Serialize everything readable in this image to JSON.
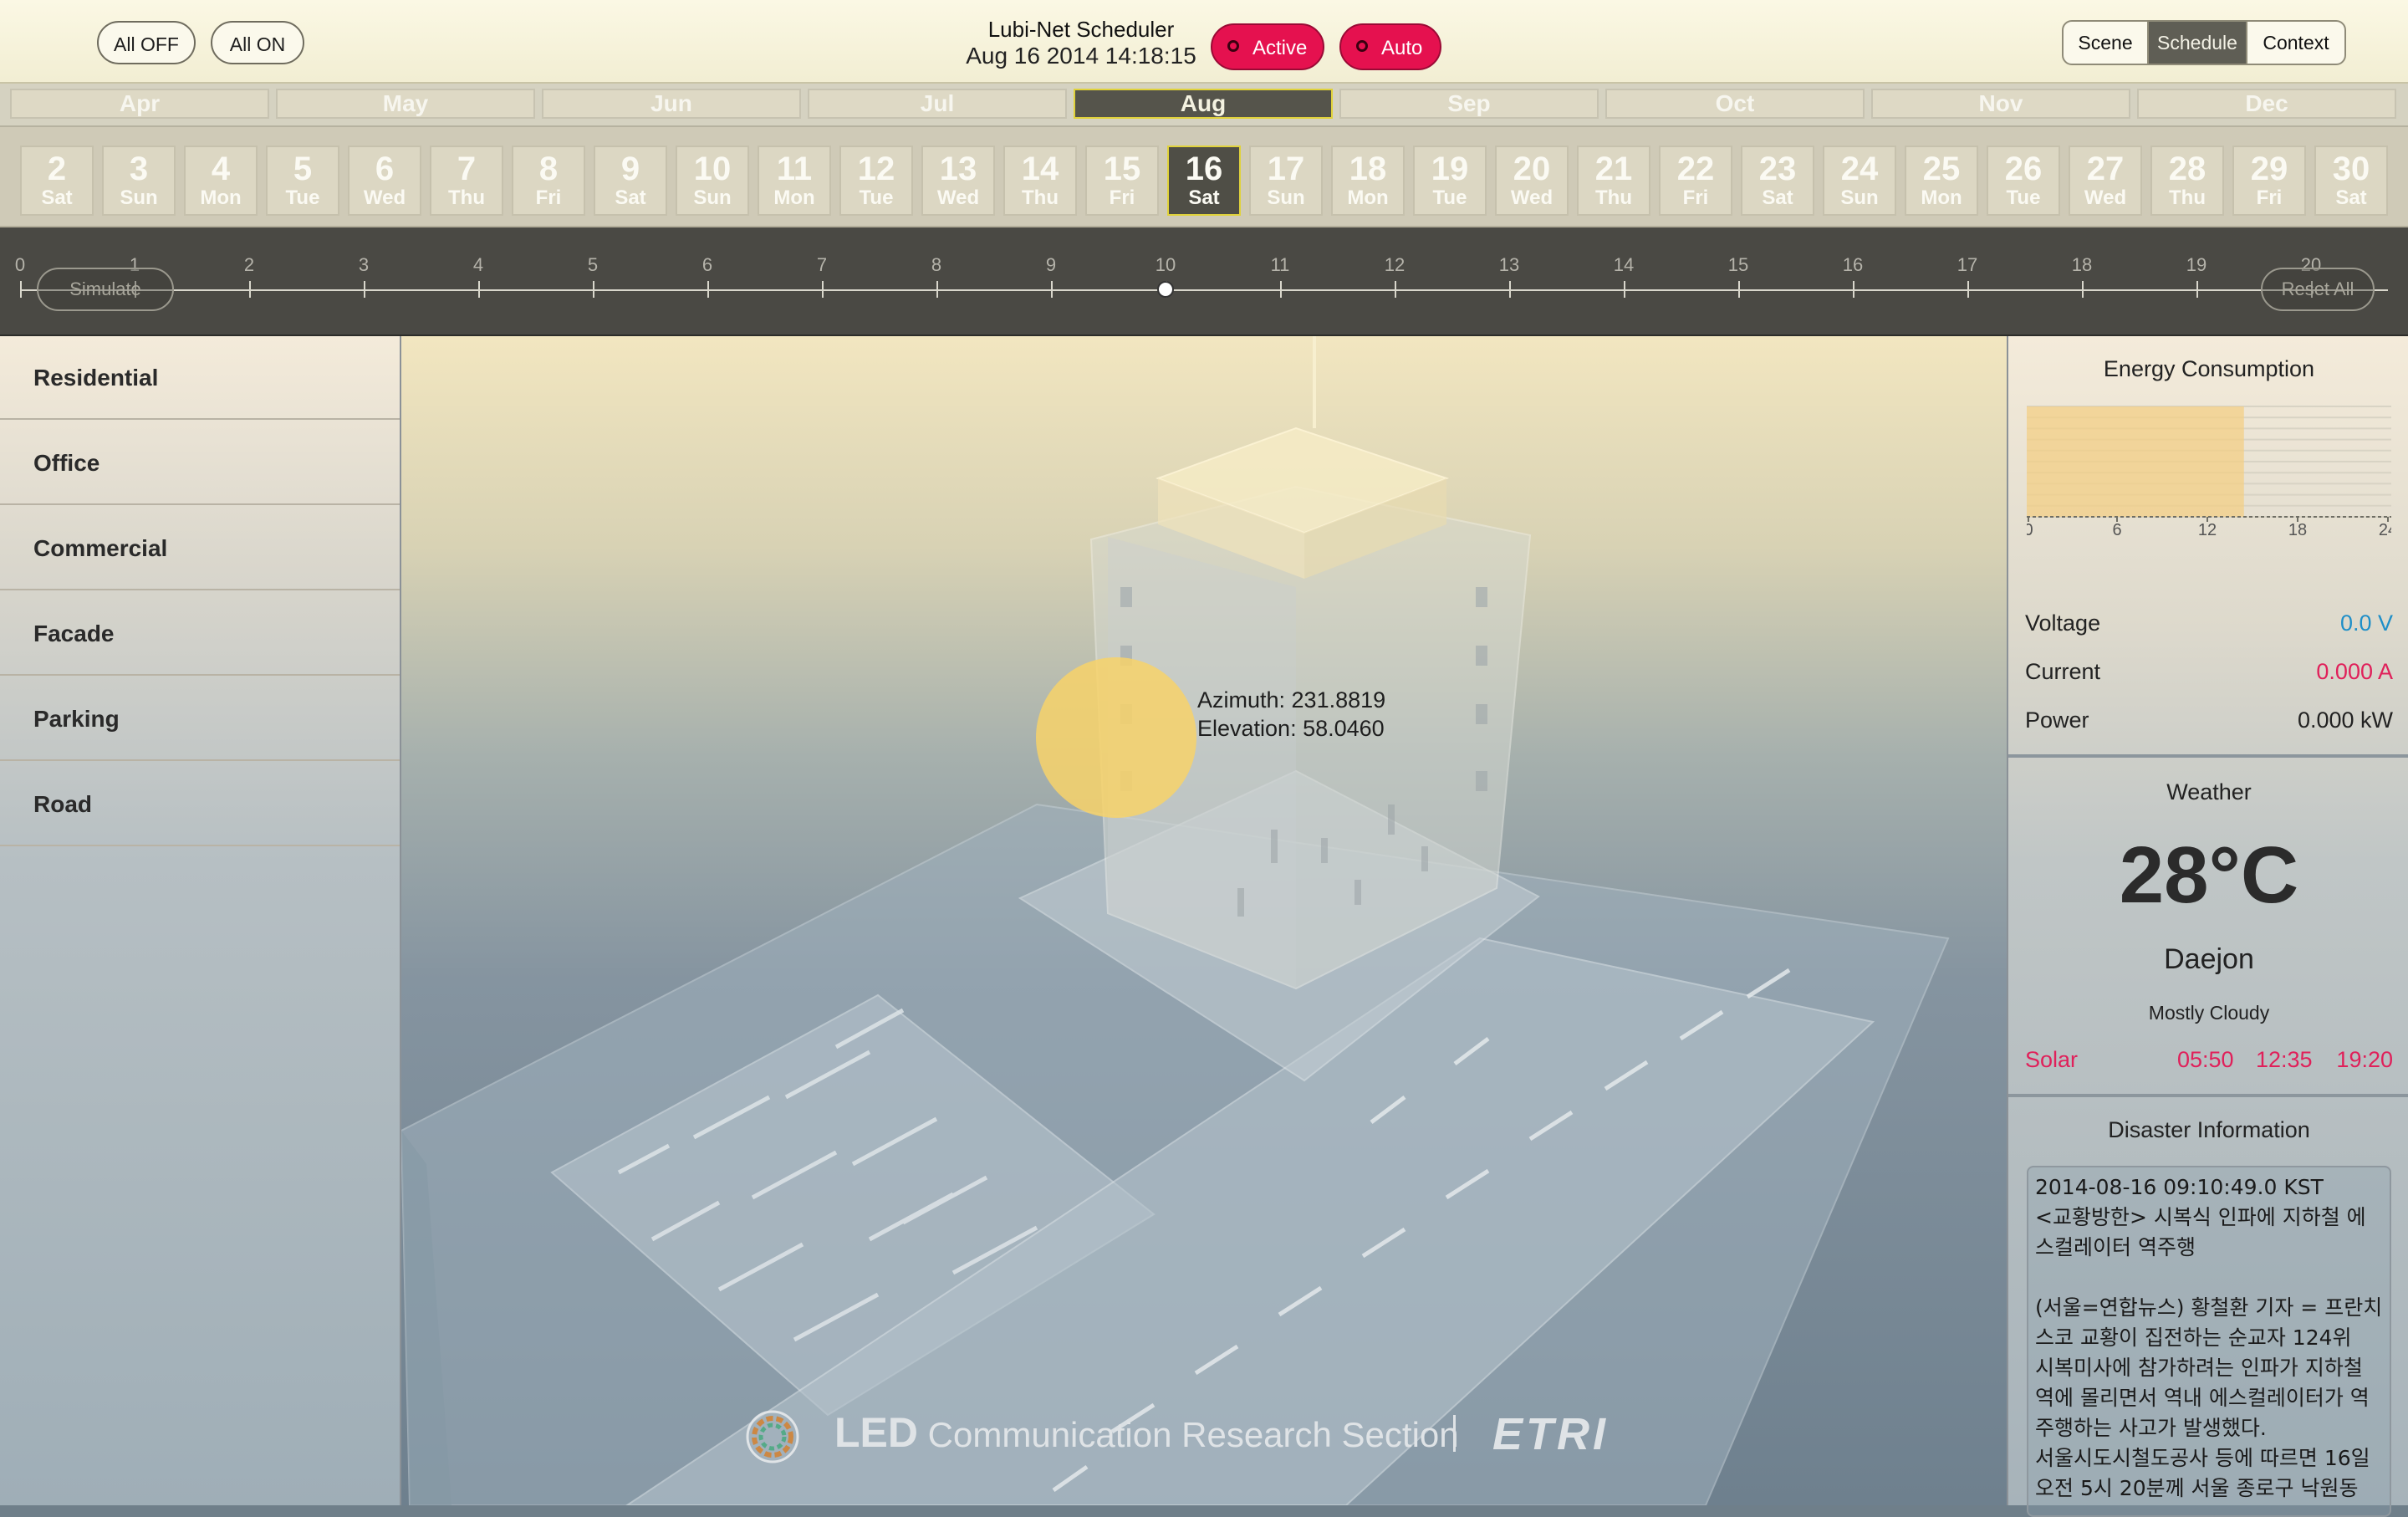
{
  "header": {
    "all_off": "All OFF",
    "all_on": "All ON",
    "title": "Lubi-Net Scheduler",
    "datetime": "Aug 16 2014 14:18:15",
    "active": "Active",
    "auto": "Auto",
    "tabs": [
      "Scene",
      "Schedule",
      "Context"
    ],
    "selected_tab": "Schedule"
  },
  "months": [
    "Apr",
    "May",
    "Jun",
    "Jul",
    "Aug",
    "Sep",
    "Oct",
    "Nov",
    "Dec"
  ],
  "selected_month": "Aug",
  "days": [
    {
      "n": "2",
      "w": "Sat"
    },
    {
      "n": "3",
      "w": "Sun"
    },
    {
      "n": "4",
      "w": "Mon"
    },
    {
      "n": "5",
      "w": "Tue"
    },
    {
      "n": "6",
      "w": "Wed"
    },
    {
      "n": "7",
      "w": "Thu"
    },
    {
      "n": "8",
      "w": "Fri"
    },
    {
      "n": "9",
      "w": "Sat"
    },
    {
      "n": "10",
      "w": "Sun"
    },
    {
      "n": "11",
      "w": "Mon"
    },
    {
      "n": "12",
      "w": "Tue"
    },
    {
      "n": "13",
      "w": "Wed"
    },
    {
      "n": "14",
      "w": "Thu"
    },
    {
      "n": "15",
      "w": "Fri"
    },
    {
      "n": "16",
      "w": "Sat"
    },
    {
      "n": "17",
      "w": "Sun"
    },
    {
      "n": "18",
      "w": "Mon"
    },
    {
      "n": "19",
      "w": "Tue"
    },
    {
      "n": "20",
      "w": "Wed"
    },
    {
      "n": "21",
      "w": "Thu"
    },
    {
      "n": "22",
      "w": "Fri"
    },
    {
      "n": "23",
      "w": "Sat"
    },
    {
      "n": "24",
      "w": "Sun"
    },
    {
      "n": "25",
      "w": "Mon"
    },
    {
      "n": "26",
      "w": "Tue"
    },
    {
      "n": "27",
      "w": "Wed"
    },
    {
      "n": "28",
      "w": "Thu"
    },
    {
      "n": "29",
      "w": "Fri"
    },
    {
      "n": "30",
      "w": "Sat"
    }
  ],
  "selected_day": "16",
  "timeline": {
    "ticks": [
      "0",
      "1",
      "2",
      "3",
      "4",
      "5",
      "6",
      "7",
      "8",
      "9",
      "10",
      "11",
      "12",
      "13",
      "14",
      "15",
      "16",
      "17",
      "18",
      "19",
      "20"
    ],
    "simulate": "Simulate",
    "reset_all": "Reset All",
    "current_hour": 10
  },
  "categories": [
    "Residential",
    "Office",
    "Commercial",
    "Facade",
    "Parking",
    "Road"
  ],
  "scene": {
    "azimuth": "Azimuth: 231.8819",
    "elevation": "Elevation: 58.0460",
    "footer_led": "LED",
    "footer_section": "Communication Research Section",
    "footer_etri": "ETRI"
  },
  "energy": {
    "title": "Energy Consumption",
    "x_ticks": [
      "0",
      "6",
      "12",
      "18",
      "24"
    ],
    "filled_hours": 14.3,
    "voltage_label": "Voltage",
    "voltage": "0.0 V",
    "current_label": "Current",
    "current": "0.000 A",
    "power_label": "Power",
    "power": "0.000 kW"
  },
  "weather": {
    "title": "Weather",
    "temp": "28°C",
    "city": "Daejon",
    "condition": "Mostly Cloudy",
    "solar_label": "Solar",
    "sunrise": "05:50",
    "noon": "12:35",
    "sunset": "19:20"
  },
  "disaster": {
    "title": "Disaster Information",
    "lines": [
      "2014-08-16 09:10:49.0 KST",
      "<교황방한> 시복식 인파에 지하철 에",
      "스컬레이터 역주행",
      "",
      "(서울=연합뉴스) 황철환 기자 = 프란치",
      "스코 교황이 집전하는 순교자 124위",
      "시복미사에 참가하려는 인파가 지하철",
      "역에 몰리면서 역내 에스컬레이터가 역",
      "주행하는 사고가 발생했다.",
      "서울시도시철도공사 등에 따르면 16일",
      "오전 5시 20분께 서울 종로구 낙원동"
    ]
  },
  "colors": {
    "accent_red": "#e5114f",
    "voltage_blue": "#1f8fc8",
    "current_red": "#e0205a",
    "selection_yellow": "#e0d23b"
  }
}
